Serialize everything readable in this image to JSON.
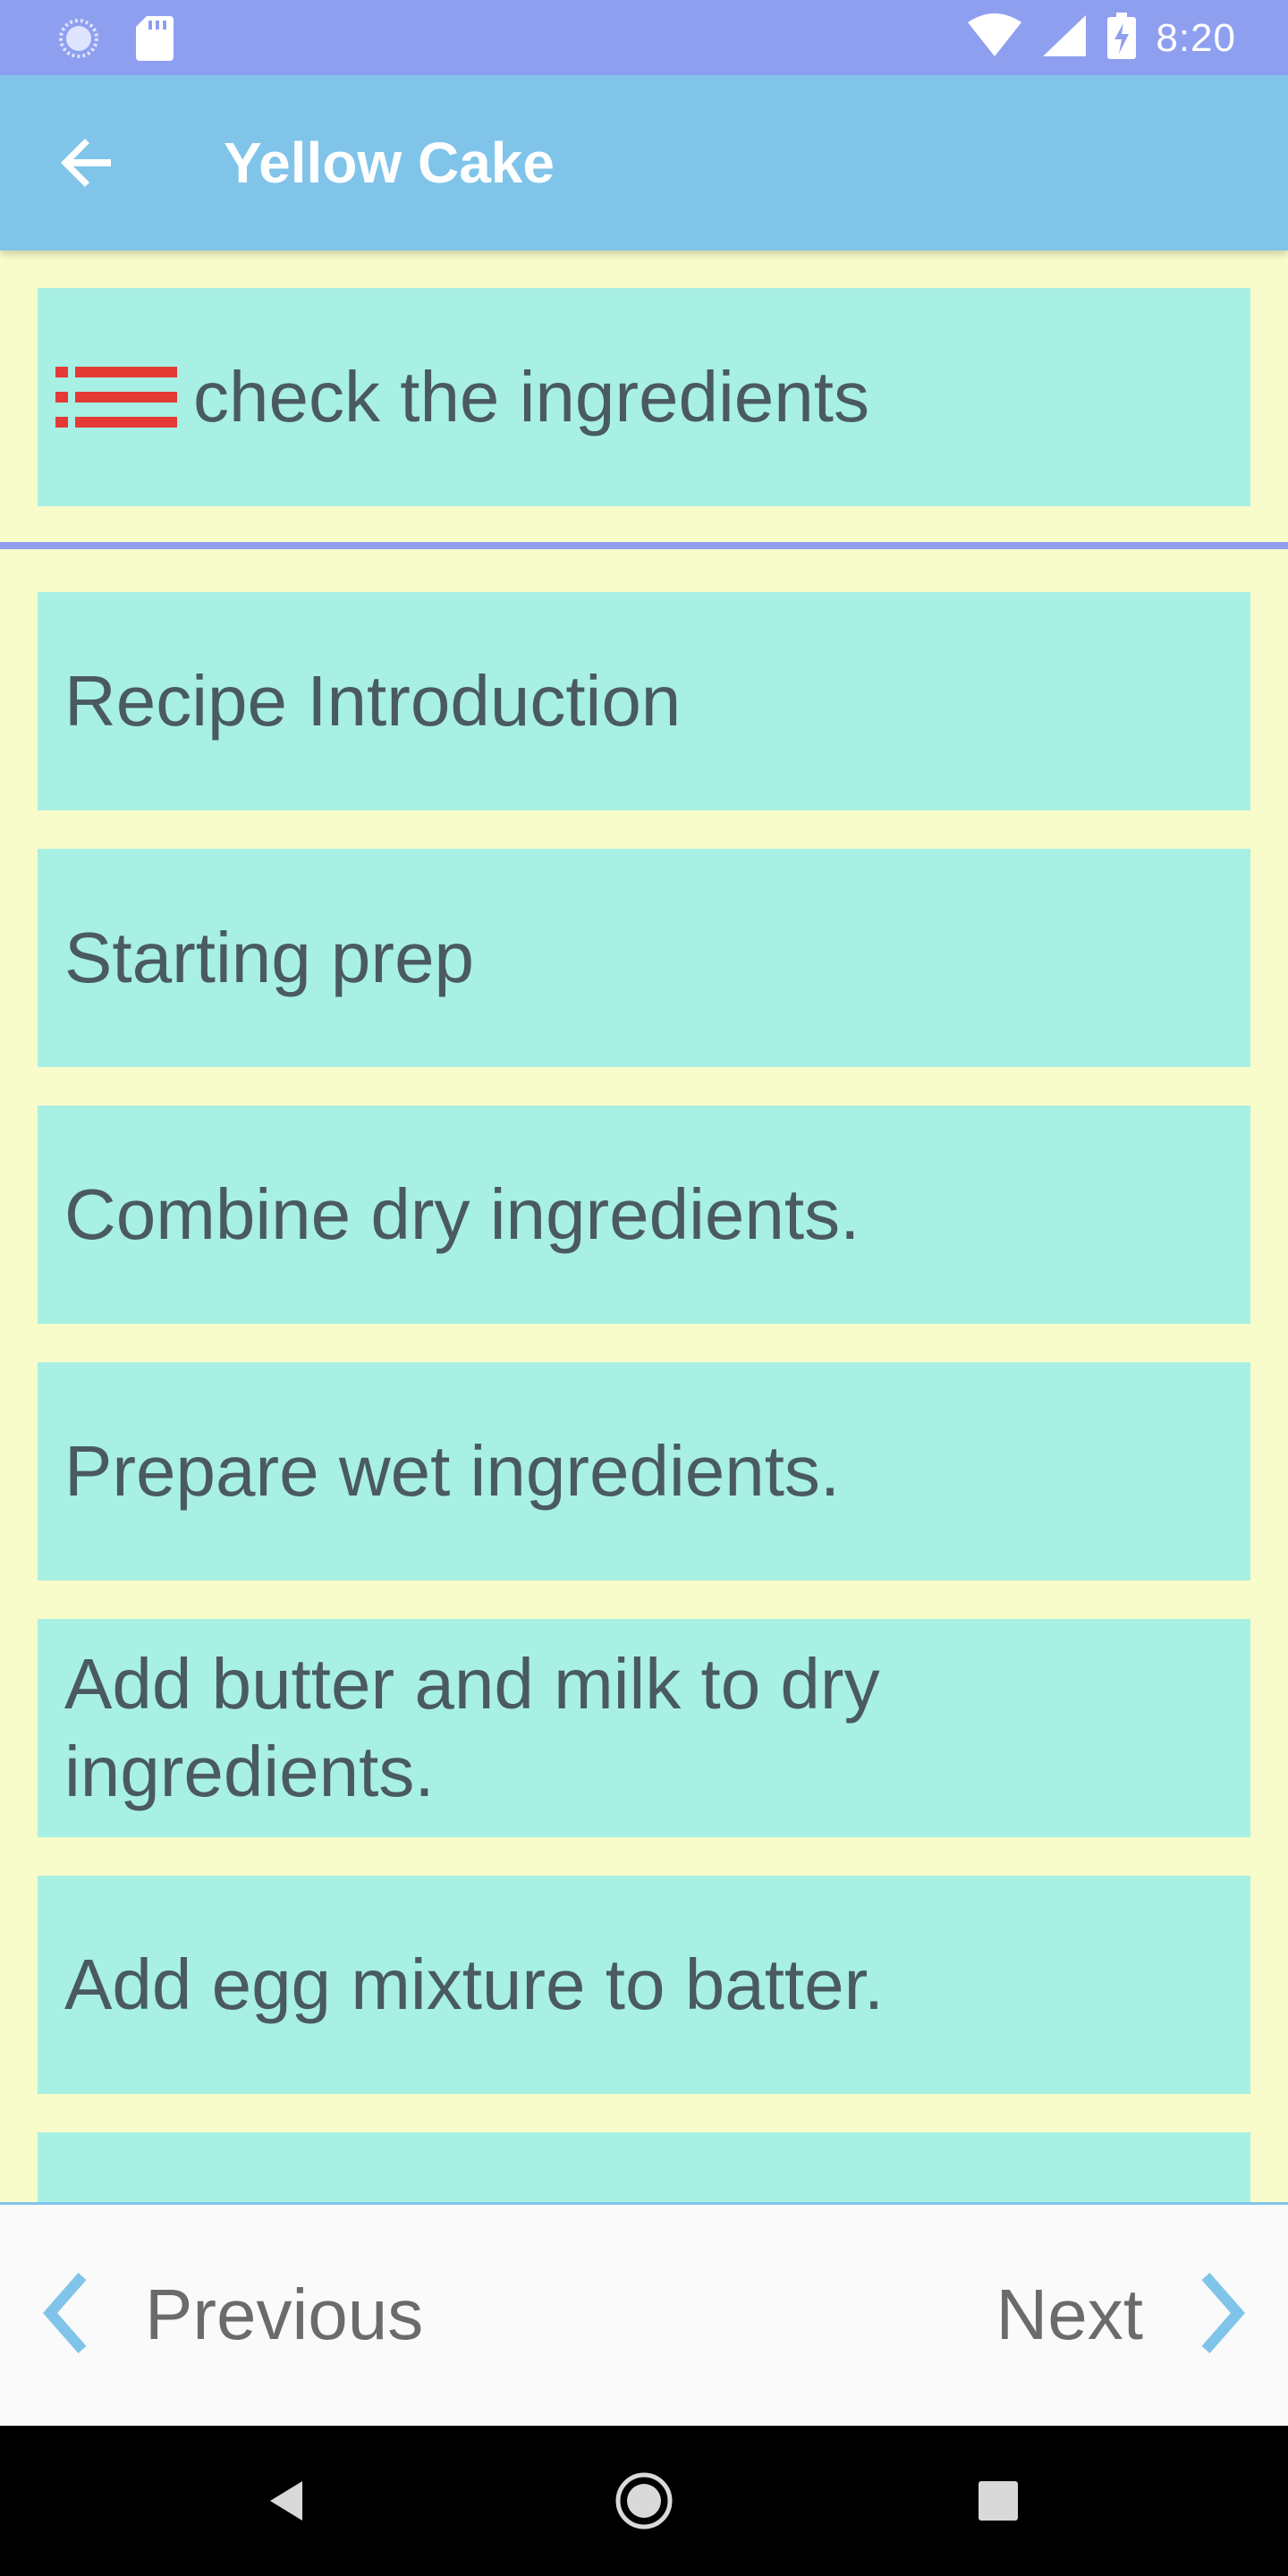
{
  "status_bar": {
    "time": "8:20",
    "left_icons": [
      "sync-icon",
      "sd-card-icon"
    ],
    "right_icons": [
      "wifi-icon",
      "signal-icon",
      "battery-charging-icon"
    ]
  },
  "app_bar": {
    "title": "Yellow Cake",
    "back_icon": "arrow-back-icon"
  },
  "header": {
    "icon": "list-icon",
    "text": "check the ingredients"
  },
  "steps": [
    {
      "label": "Recipe Introduction"
    },
    {
      "label": "Starting prep"
    },
    {
      "label": "Combine dry ingredients."
    },
    {
      "label": "Prepare wet ingredients."
    },
    {
      "label": "Add butter and milk to dry ingredients."
    },
    {
      "label": "Add egg mixture to batter."
    },
    {
      "label": ""
    }
  ],
  "bottom_nav": {
    "previous_label": "Previous",
    "next_label": "Next"
  },
  "colors": {
    "status_bar": "#8f9ff0",
    "app_bar": "#80c4ea",
    "background": "#f8fbca",
    "card": "#a7f0e3",
    "list_icon": "#e53935",
    "chevron": "#80c4ea"
  }
}
